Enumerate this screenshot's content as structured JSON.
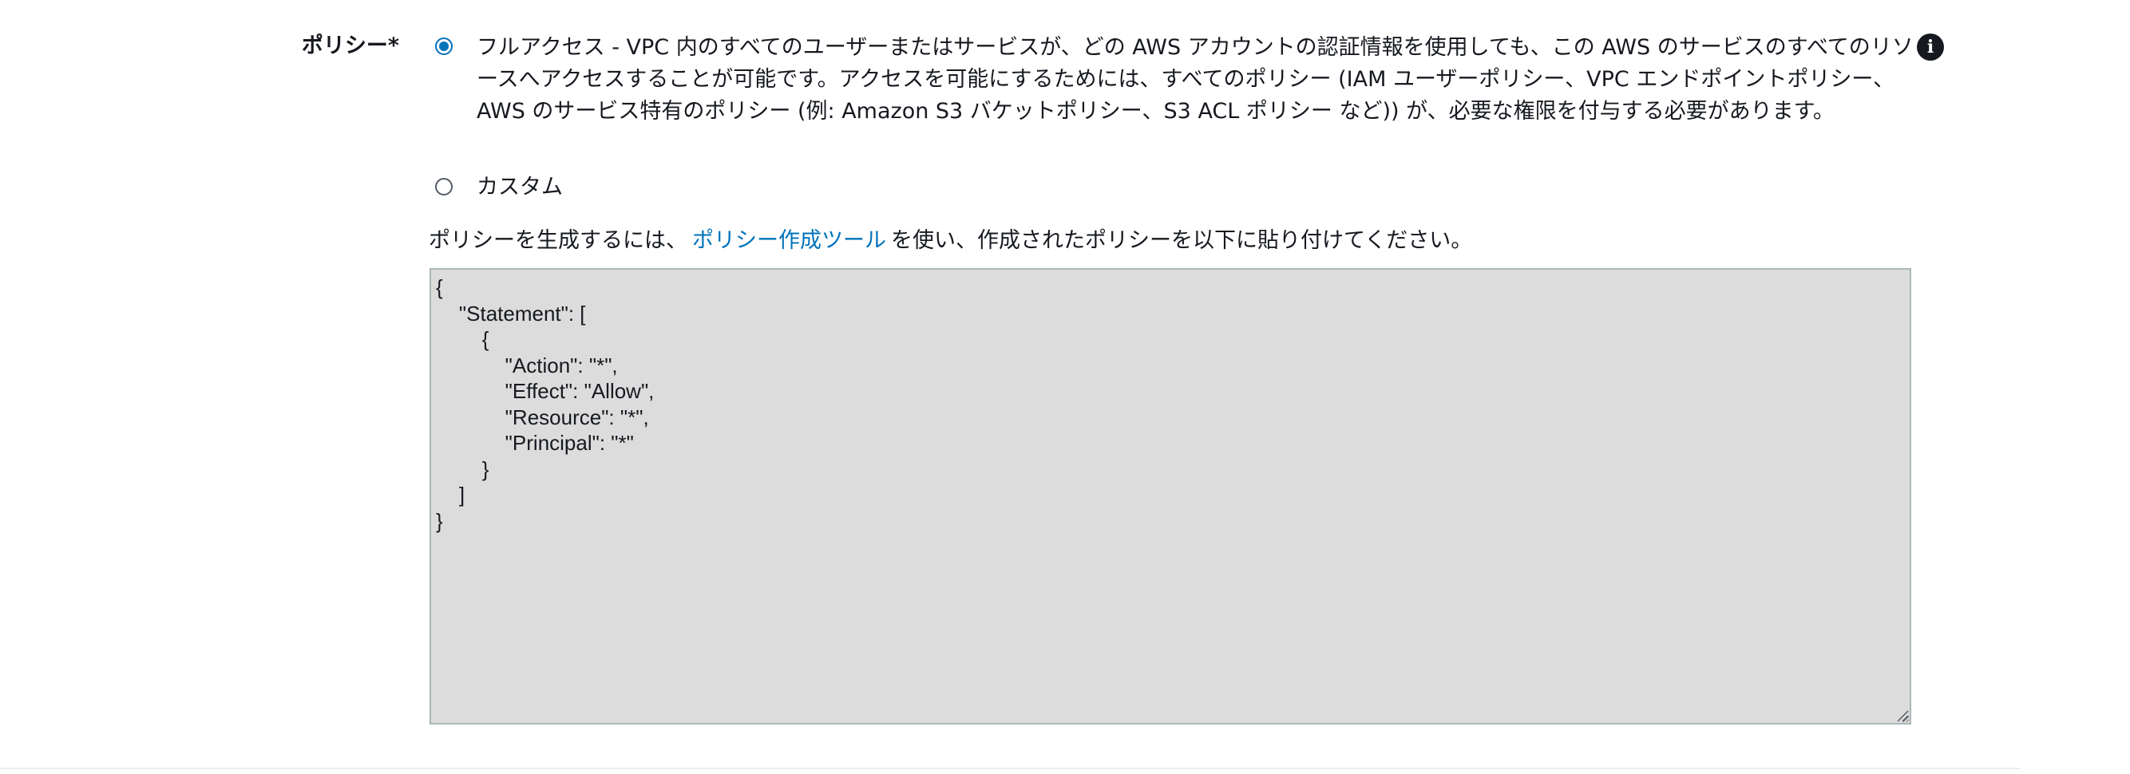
{
  "policy": {
    "label": "ポリシー*",
    "options": [
      {
        "label": "フルアクセス - VPC 内のすべてのユーザーまたはサービスが、どの AWS アカウントの認証情報を使用しても、この AWS のサービスのすべてのリソースへアクセスすることが可能です。アクセスを可能にするためには、すべてのポリシー (IAM ユーザーポリシー、VPC エンドポイントポリシー、AWS のサービス特有のポリシー (例: Amazon S3 バケットポリシー、S3 ACL ポリシー など)) が、必要な権限を付与する必要があります。",
        "selected": true
      },
      {
        "label": "カスタム",
        "selected": false
      }
    ],
    "info_icon": "info-icon",
    "instruction_prefix": "ポリシーを生成するには、",
    "instruction_link": "ポリシー作成ツール",
    "instruction_suffix": "を使い、作成されたポリシーを以下に貼り付けてください。",
    "document": "{\n    \"Statement\": [\n        {\n            \"Action\": \"*\",\n            \"Effect\": \"Allow\",\n            \"Resource\": \"*\",\n            \"Principal\": \"*\"\n        }\n    ]\n}"
  },
  "colors": {
    "accent": "#0073bb",
    "text": "#16191f",
    "editor_background": "#dcdcdc"
  }
}
